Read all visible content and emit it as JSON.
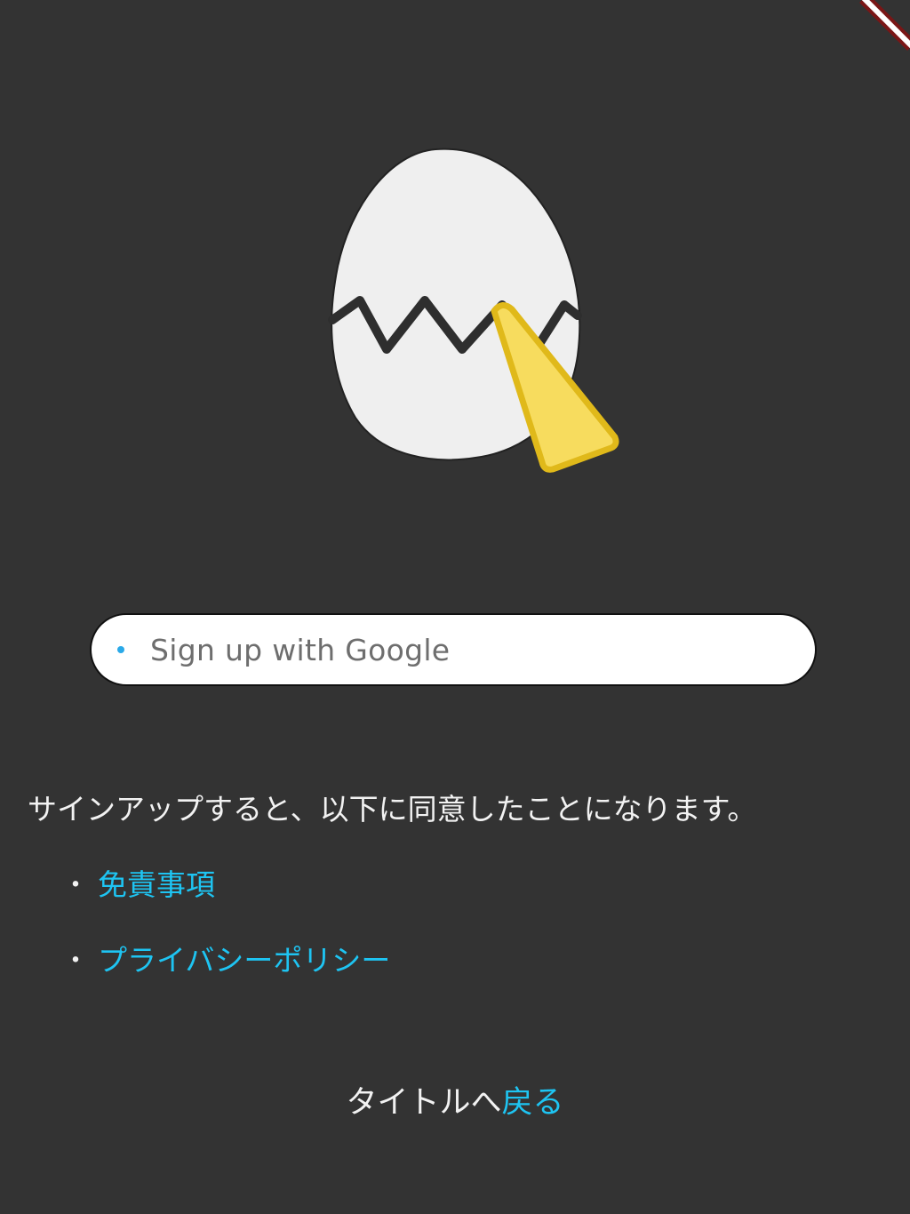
{
  "signup": {
    "button_label": "Sign up with Google"
  },
  "agreement": {
    "text": "サインアップすると、以下に同意したことになります。",
    "items": [
      {
        "bullet": "・",
        "label": "免責事項"
      },
      {
        "bullet": "・",
        "label": "プライバシーポリシー"
      }
    ]
  },
  "footer": {
    "prefix": "タイトルへ",
    "back_label": "戻る"
  },
  "colors": {
    "background": "#333333",
    "link": "#1ec4f2",
    "egg": "#efefef",
    "beak": "#f7dc5e",
    "ribbon": "#7a1616"
  },
  "icons": {
    "logo": "egg-hatching-icon",
    "google": "google-dot-icon"
  }
}
